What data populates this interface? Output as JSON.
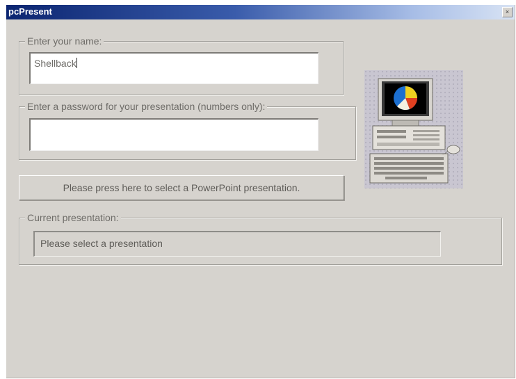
{
  "window": {
    "title": "pcPresent",
    "close_glyph": "×"
  },
  "name_group": {
    "legend": "Enter your name:",
    "value": "Shellback"
  },
  "password_group": {
    "legend": "Enter a password for your presentation (numbers only):",
    "value": ""
  },
  "select_button": {
    "label": "Please press here to select a PowerPoint presentation."
  },
  "current_group": {
    "legend": "Current presentation:",
    "value": "Please select a presentation"
  },
  "illustration": {
    "icon": "computer-with-pie-chart-icon"
  }
}
